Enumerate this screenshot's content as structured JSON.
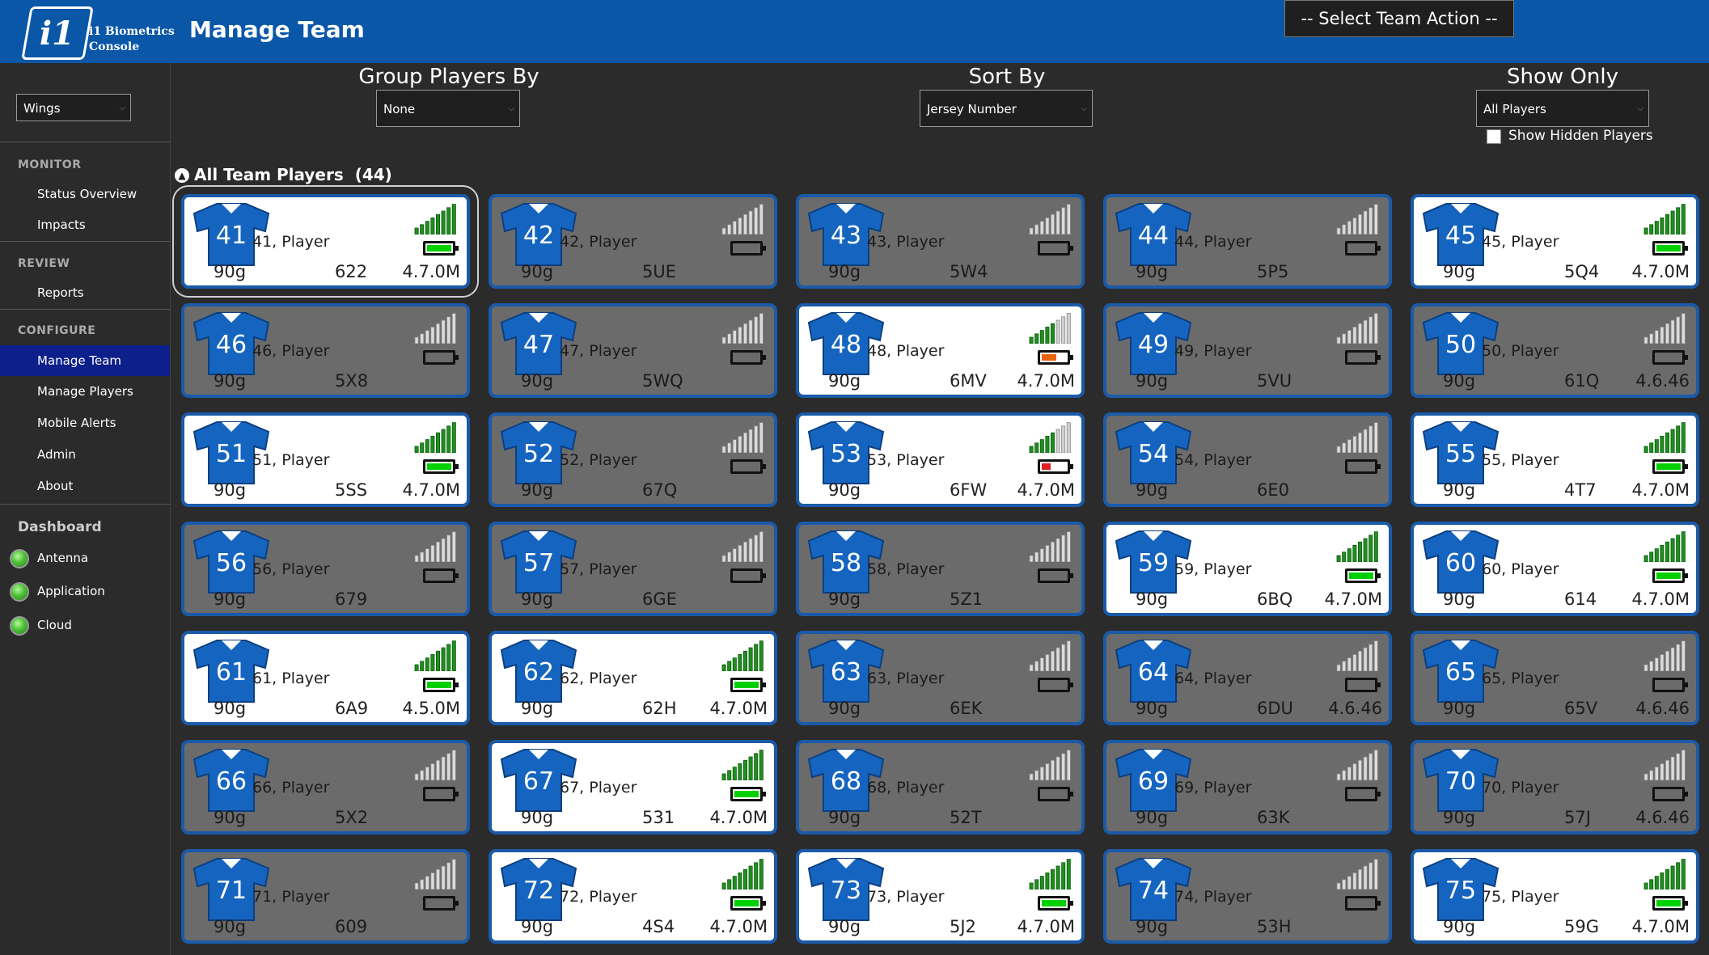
{
  "header": {
    "logo_text": "i1",
    "brand_line1": "i1 Biometrics",
    "brand_line2": "Console",
    "title": "Manage Team",
    "team_action": "-- Select Team Action --"
  },
  "sidebar": {
    "team_select": "Wings",
    "monitor_label": "MONITOR",
    "review_label": "REVIEW",
    "configure_label": "CONFIGURE",
    "items": {
      "status_overview": "Status Overview",
      "impacts": "Impacts",
      "reports": "Reports",
      "manage_team": "Manage Team",
      "manage_players": "Manage Players",
      "mobile_alerts": "Mobile Alerts",
      "admin": "Admin",
      "about": "About"
    },
    "dashboard_label": "Dashboard",
    "dashboard": {
      "antenna": "Antenna",
      "application": "Application",
      "cloud": "Cloud"
    }
  },
  "controls": {
    "group_label": "Group Players By",
    "group_value": "None",
    "sort_label": "Sort By",
    "sort_value": "Jersey Number",
    "show_label": "Show Only",
    "show_value": "All Players",
    "show_hidden_label": "Show Hidden Players"
  },
  "group": {
    "title": "All Team Players",
    "count": "(44)"
  },
  "colors": {
    "header_blue": "#0a57a8",
    "card_border": "#1b5aa8",
    "jersey_blue": "#1565c0",
    "battery_green": "#00d000",
    "battery_orange": "#e8640a",
    "battery_red": "#e02020"
  },
  "players": [
    {
      "num": "41",
      "name": "41, Player",
      "weight": "90g",
      "code": "622",
      "fw": "4.7.0M",
      "active": true,
      "battery": "green",
      "battery_level": 1.0,
      "signal": 5,
      "selected": true
    },
    {
      "num": "42",
      "name": "42, Player",
      "weight": "90g",
      "code": "5UE",
      "fw": "",
      "active": false,
      "battery": "none",
      "battery_level": 0,
      "signal": 0
    },
    {
      "num": "43",
      "name": "43, Player",
      "weight": "90g",
      "code": "5W4",
      "fw": "",
      "active": false,
      "battery": "none",
      "battery_level": 0,
      "signal": 0
    },
    {
      "num": "44",
      "name": "44, Player",
      "weight": "90g",
      "code": "5P5",
      "fw": "",
      "active": false,
      "battery": "none",
      "battery_level": 0,
      "signal": 0
    },
    {
      "num": "45",
      "name": "45, Player",
      "weight": "90g",
      "code": "5Q4",
      "fw": "4.7.0M",
      "active": true,
      "battery": "green",
      "battery_level": 1.0,
      "signal": 5
    },
    {
      "num": "46",
      "name": "46, Player",
      "weight": "90g",
      "code": "5X8",
      "fw": "",
      "active": false,
      "battery": "none",
      "battery_level": 0,
      "signal": 0
    },
    {
      "num": "47",
      "name": "47, Player",
      "weight": "90g",
      "code": "5WQ",
      "fw": "",
      "active": false,
      "battery": "none",
      "battery_level": 0,
      "signal": 0
    },
    {
      "num": "48",
      "name": "48, Player",
      "weight": "90g",
      "code": "6MV",
      "fw": "4.7.0M",
      "active": true,
      "battery": "orange",
      "battery_level": 0.6,
      "signal": 4
    },
    {
      "num": "49",
      "name": "49, Player",
      "weight": "90g",
      "code": "5VU",
      "fw": "",
      "active": false,
      "battery": "none",
      "battery_level": 0,
      "signal": 0
    },
    {
      "num": "50",
      "name": "50, Player",
      "weight": "90g",
      "code": "61Q",
      "fw": "4.6.46",
      "active": false,
      "battery": "none",
      "battery_level": 0,
      "signal": 0
    },
    {
      "num": "51",
      "name": "51, Player",
      "weight": "90g",
      "code": "5SS",
      "fw": "4.7.0M",
      "active": true,
      "battery": "green",
      "battery_level": 1.0,
      "signal": 5
    },
    {
      "num": "52",
      "name": "52, Player",
      "weight": "90g",
      "code": "67Q",
      "fw": "",
      "active": false,
      "battery": "none",
      "battery_level": 0,
      "signal": 0
    },
    {
      "num": "53",
      "name": "53, Player",
      "weight": "90g",
      "code": "6FW",
      "fw": "4.7.0M",
      "active": true,
      "battery": "red",
      "battery_level": 0.35,
      "signal": 4
    },
    {
      "num": "54",
      "name": "54, Player",
      "weight": "90g",
      "code": "6E0",
      "fw": "",
      "active": false,
      "battery": "none",
      "battery_level": 0,
      "signal": 0
    },
    {
      "num": "55",
      "name": "55, Player",
      "weight": "90g",
      "code": "4T7",
      "fw": "4.7.0M",
      "active": true,
      "battery": "green",
      "battery_level": 1.0,
      "signal": 5
    },
    {
      "num": "56",
      "name": "56, Player",
      "weight": "90g",
      "code": "679",
      "fw": "",
      "active": false,
      "battery": "none",
      "battery_level": 0,
      "signal": 0
    },
    {
      "num": "57",
      "name": "57, Player",
      "weight": "90g",
      "code": "6GE",
      "fw": "",
      "active": false,
      "battery": "none",
      "battery_level": 0,
      "signal": 0
    },
    {
      "num": "58",
      "name": "58, Player",
      "weight": "90g",
      "code": "5Z1",
      "fw": "",
      "active": false,
      "battery": "none",
      "battery_level": 0,
      "signal": 0
    },
    {
      "num": "59",
      "name": "59, Player",
      "weight": "90g",
      "code": "6BQ",
      "fw": "4.7.0M",
      "active": true,
      "battery": "green",
      "battery_level": 1.0,
      "signal": 5
    },
    {
      "num": "60",
      "name": "60, Player",
      "weight": "90g",
      "code": "614",
      "fw": "4.7.0M",
      "active": true,
      "battery": "green",
      "battery_level": 1.0,
      "signal": 5
    },
    {
      "num": "61",
      "name": "61, Player",
      "weight": "90g",
      "code": "6A9",
      "fw": "4.5.0M",
      "active": true,
      "battery": "green",
      "battery_level": 1.0,
      "signal": 5
    },
    {
      "num": "62",
      "name": "62, Player",
      "weight": "90g",
      "code": "62H",
      "fw": "4.7.0M",
      "active": true,
      "battery": "green",
      "battery_level": 1.0,
      "signal": 5
    },
    {
      "num": "63",
      "name": "63, Player",
      "weight": "90g",
      "code": "6EK",
      "fw": "",
      "active": false,
      "battery": "none",
      "battery_level": 0,
      "signal": 0
    },
    {
      "num": "64",
      "name": "64, Player",
      "weight": "90g",
      "code": "6DU",
      "fw": "4.6.46",
      "active": false,
      "battery": "none",
      "battery_level": 0,
      "signal": 0
    },
    {
      "num": "65",
      "name": "65, Player",
      "weight": "90g",
      "code": "65V",
      "fw": "4.6.46",
      "active": false,
      "battery": "none",
      "battery_level": 0,
      "signal": 0
    },
    {
      "num": "66",
      "name": "66, Player",
      "weight": "90g",
      "code": "5X2",
      "fw": "",
      "active": false,
      "battery": "none",
      "battery_level": 0,
      "signal": 0
    },
    {
      "num": "67",
      "name": "67, Player",
      "weight": "90g",
      "code": "531",
      "fw": "4.7.0M",
      "active": true,
      "battery": "green",
      "battery_level": 1.0,
      "signal": 5
    },
    {
      "num": "68",
      "name": "68, Player",
      "weight": "90g",
      "code": "52T",
      "fw": "",
      "active": false,
      "battery": "none",
      "battery_level": 0,
      "signal": 0
    },
    {
      "num": "69",
      "name": "69, Player",
      "weight": "90g",
      "code": "63K",
      "fw": "",
      "active": false,
      "battery": "none",
      "battery_level": 0,
      "signal": 0
    },
    {
      "num": "70",
      "name": "70, Player",
      "weight": "90g",
      "code": "57J",
      "fw": "4.6.46",
      "active": false,
      "battery": "none",
      "battery_level": 0,
      "signal": 0
    },
    {
      "num": "71",
      "name": "71, Player",
      "weight": "90g",
      "code": "609",
      "fw": "",
      "active": false,
      "battery": "none",
      "battery_level": 0,
      "signal": 0
    },
    {
      "num": "72",
      "name": "72, Player",
      "weight": "90g",
      "code": "4S4",
      "fw": "4.7.0M",
      "active": true,
      "battery": "green",
      "battery_level": 1.0,
      "signal": 5
    },
    {
      "num": "73",
      "name": "73, Player",
      "weight": "90g",
      "code": "5J2",
      "fw": "4.7.0M",
      "active": true,
      "battery": "green",
      "battery_level": 1.0,
      "signal": 5
    },
    {
      "num": "74",
      "name": "74, Player",
      "weight": "90g",
      "code": "53H",
      "fw": "",
      "active": false,
      "battery": "none",
      "battery_level": 0,
      "signal": 0
    },
    {
      "num": "75",
      "name": "75, Player",
      "weight": "90g",
      "code": "59G",
      "fw": "4.7.0M",
      "active": true,
      "battery": "green",
      "battery_level": 1.0,
      "signal": 5
    }
  ]
}
